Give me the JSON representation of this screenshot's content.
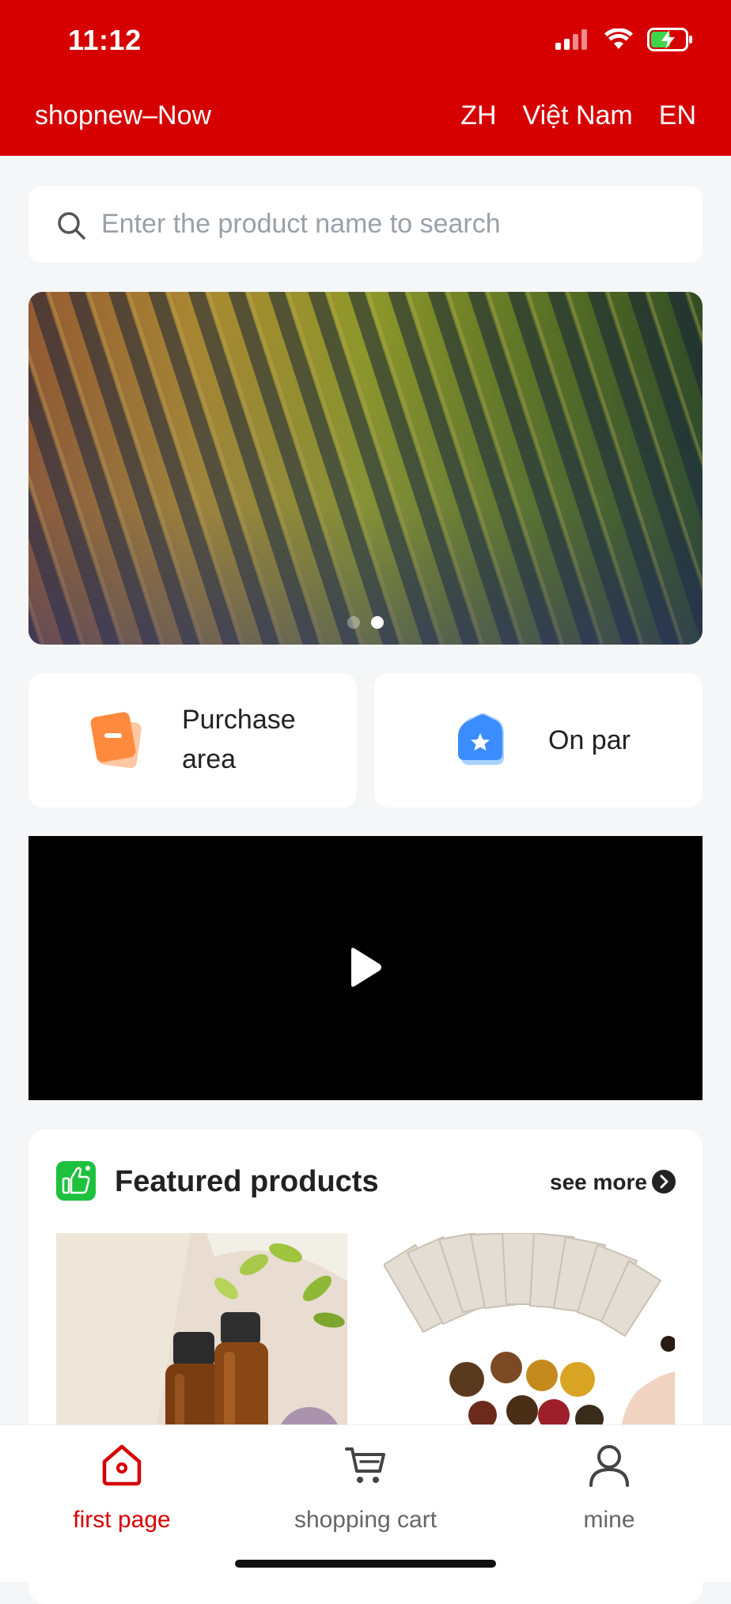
{
  "status_bar": {
    "time": "11:12"
  },
  "header": {
    "app_name": "shopnew–Now",
    "languages": [
      "ZH",
      "Việt Nam",
      "EN"
    ]
  },
  "search": {
    "placeholder": "Enter the product name to search"
  },
  "banner": {
    "slide_count": 2,
    "active_slide": 2
  },
  "quick_links": [
    {
      "label_line1": "Purchase",
      "label_line2": "area",
      "icon": "purchase-tag-icon"
    },
    {
      "label": "On par",
      "icon": "star-house-icon"
    }
  ],
  "video": {
    "icon": "play-icon"
  },
  "featured": {
    "title": "Featured products",
    "see_more": "see more",
    "icon": "thumbs-up-icon"
  },
  "tabbar": {
    "items": [
      {
        "label": "first page",
        "icon": "home-icon",
        "active": true
      },
      {
        "label": "shopping cart",
        "icon": "cart-icon",
        "active": false
      },
      {
        "label": "mine",
        "icon": "user-icon",
        "active": false
      }
    ]
  },
  "colors": {
    "brand_red": "#d60000",
    "background": "#f5f6f8",
    "accent_green": "#1ec13d"
  }
}
